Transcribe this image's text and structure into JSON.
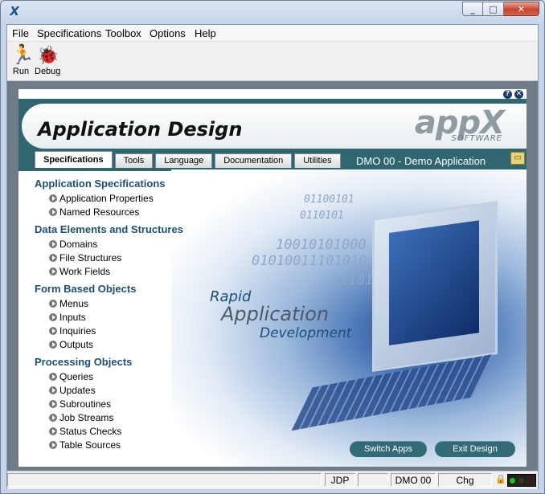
{
  "window": {
    "icon": "appx-icon"
  },
  "menubar": {
    "items": [
      "File",
      "Specifications",
      "Toolbox",
      "Options",
      "Help"
    ]
  },
  "toolbar": {
    "run_label": "Run",
    "debug_label": "Debug"
  },
  "header": {
    "title": "Application Design",
    "logo_text": "appX",
    "logo_sub": "SOFTWARE",
    "help_glyph": "?",
    "close_glyph": "✕"
  },
  "tabs": [
    "Specifications",
    "Tools",
    "Language",
    "Documentation",
    "Utilities"
  ],
  "current_app": "DMO 00 - Demo Application",
  "nav": {
    "sections": [
      {
        "title": "Application Specifications",
        "items": [
          "Application Properties",
          "Named Resources"
        ]
      },
      {
        "title": "Data Elements and Structures",
        "items": [
          "Domains",
          "File Structures",
          "Work Fields"
        ]
      },
      {
        "title": "Form Based Objects",
        "items": [
          "Menus",
          "Inputs",
          "Inquiries",
          "Outputs"
        ]
      },
      {
        "title": "Processing Objects",
        "items": [
          "Queries",
          "Updates",
          "Subroutines",
          "Job Streams",
          "Status Checks",
          "Table Sources"
        ]
      }
    ]
  },
  "art": {
    "line1": "Rapid",
    "line2": "Application",
    "line3": "Development",
    "binary": [
      "01100101",
      "0110101",
      "10010101000",
      "01010011101010",
      "1110101000"
    ]
  },
  "buttons": {
    "switch_apps": "Switch Apps",
    "exit_design": "Exit Design"
  },
  "status": {
    "user": "JDP",
    "app": "DMO 00",
    "mode": "Chg"
  },
  "colors": {
    "header_teal": "#2f6670",
    "section_blue": "#1e4f72",
    "button_teal": "#336a78"
  }
}
